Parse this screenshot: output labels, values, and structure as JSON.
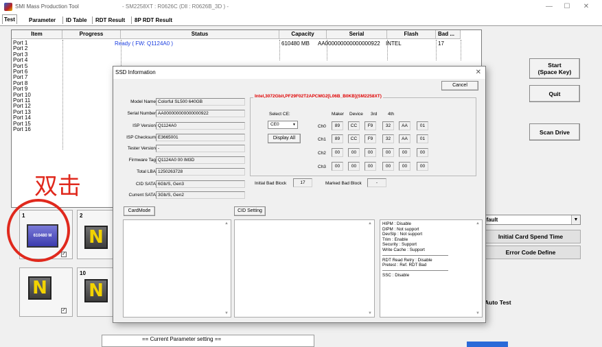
{
  "window": {
    "title": "SMI Mass Production Tool",
    "subtitle": "- SM2258XT : R0626C  (Dll : R0626B_3D ) -",
    "minimize": "—",
    "maximize": "☐",
    "close": "✕"
  },
  "tabs": [
    "Test",
    "Parameter",
    "ID Table",
    "RDT Result",
    "8P RDT Result"
  ],
  "grid": {
    "headers": [
      "Item",
      "Progress",
      "Status",
      "Capacity",
      "Serial",
      "Flash",
      "Bad ..."
    ],
    "ports": [
      "Port 1",
      "Port 2",
      "Port 3",
      "Port 4",
      "Port 5",
      "Port 6",
      "Port 7",
      "Port 8",
      "Port 9",
      "Port 10",
      "Port 11",
      "Port 12",
      "Port 13",
      "Port 14",
      "Port 15",
      "Port 16"
    ],
    "row1": {
      "status": "Ready ( FW: Q1124A0 )",
      "capacity": "610480 MB",
      "serial": "AA000000000000000922",
      "flash": "INTEL",
      "bad": "17"
    }
  },
  "buttons": {
    "start": "Start\n(Space Key)",
    "quit": "Quit",
    "scan": "Scan Drive",
    "profile": "efault",
    "initial": "Initial Card Spend Time",
    "error": "Error Code Define",
    "auto_test": "Auto Test"
  },
  "slots": {
    "s1_num": "1",
    "s1_label": "610480 M",
    "s1_check": "✓",
    "s2_num": "2",
    "s2_glyph": "N",
    "s9_glyph": "N",
    "s9_check": "✓",
    "s10_num": "10",
    "s10_glyph": "N"
  },
  "annotation": {
    "text": "双击"
  },
  "param": {
    "text": "== Current Parameter setting =="
  },
  "dialog": {
    "title": "SSD Information",
    "close": "✕",
    "cancel": "Cancel",
    "fields": [
      {
        "label": "Model Name",
        "value": "Colorful SL500 640GB"
      },
      {
        "label": "Serial Number",
        "value": "AA000000000000000922"
      },
      {
        "label": "ISP Version",
        "value": "Q1124A0"
      },
      {
        "label": "ISP Checksum",
        "value": "E3665001"
      },
      {
        "label": "Tester Version",
        "value": "-"
      },
      {
        "label": "Firmware Tag",
        "value": "Q1124A0 00  IM3D"
      },
      {
        "label": "Total LBA",
        "value": "1250263728"
      },
      {
        "label": "CID SATA",
        "value": "6Gb/S, Gen3"
      },
      {
        "label": "Current SATA",
        "value": "3Gb/S, Gen2"
      }
    ],
    "flash_title": "Intel,3072Gbit,PF29F02T2APCMG2[L06B_B0KB](SM2258XT)",
    "select_ce_label": "Select CE:",
    "ce_value": "CE0",
    "display_all": "Display All",
    "id_headers": [
      "Maker",
      "Device",
      "3rd",
      "4th"
    ],
    "channels": [
      {
        "name": "Ch0",
        "bytes": [
          "89",
          "CC",
          "F9",
          "32",
          "AA",
          "01"
        ]
      },
      {
        "name": "Ch1",
        "bytes": [
          "89",
          "CC",
          "F9",
          "32",
          "AA",
          "01"
        ]
      },
      {
        "name": "Ch2",
        "bytes": [
          "00",
          "00",
          "00",
          "00",
          "00",
          "00"
        ]
      },
      {
        "name": "Ch3",
        "bytes": [
          "00",
          "00",
          "00",
          "00",
          "00",
          "00"
        ]
      }
    ],
    "initial_bad_label": "Initial Bad Block",
    "initial_bad_value": "17",
    "marked_bad_label": "Marked Bad Block",
    "marked_bad_value": "-",
    "cardmode": "CardMode",
    "cid_setting": "CID Setting",
    "info_block1": [
      "HIPM : Disable",
      "DIPM : Not support",
      "DevSlp : Not support",
      "Trim : Enable",
      "Security : Support",
      "Write Cache : Support"
    ],
    "info_block2": [
      "RDT Read Retry : Disable",
      "Pretest : Ref. RDT Bad"
    ],
    "info_block3": [
      "SSC : Disable"
    ]
  }
}
